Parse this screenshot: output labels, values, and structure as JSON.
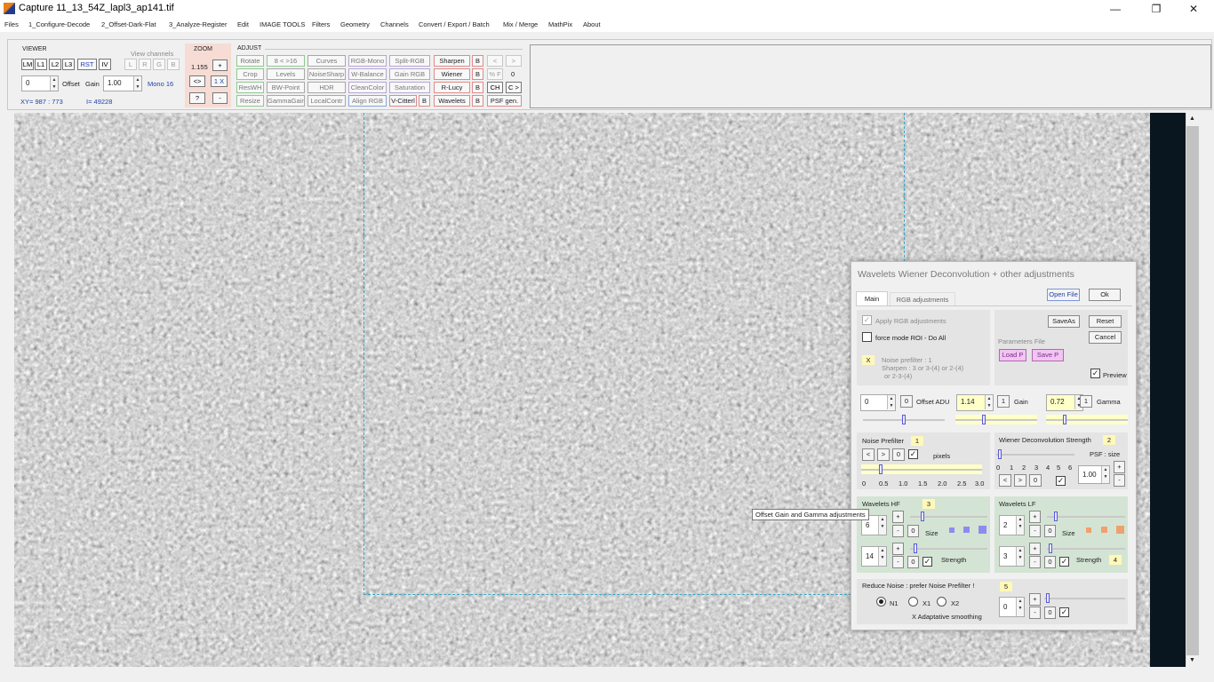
{
  "window": {
    "title": "Capture 11_13_54Z_lapl3_ap141.tif",
    "minimize": "—",
    "maximize": "❐",
    "close": "✕"
  },
  "menu": [
    "Files",
    "1_Configure-Decode",
    "2_Offset-Dark-Flat",
    "3_Analyze-Register",
    "Edit",
    "IMAGE TOOLS",
    "Filters",
    "Geometry",
    "Channels",
    "Convert / Export / Batch",
    "Mix / Merge",
    "MathPix",
    "About"
  ],
  "viewer": {
    "title": "VIEWER",
    "buttons": [
      "LM",
      "L1",
      "L2",
      "L3",
      "RST",
      "IV"
    ],
    "view_channels_label": "View channels",
    "channel_buttons": [
      "L",
      "R",
      "G",
      "B"
    ],
    "offset_value": "0",
    "offset_label": "Offset",
    "gain_label": "Gain",
    "gain_value": "1.00",
    "mode": "Mono 16",
    "xy": "XY= 987 : 773",
    "intensity": "I= 49228"
  },
  "zoom": {
    "title": "ZOOM",
    "value": "1.155",
    "plus": "+",
    "fit": "<>",
    "one_x": "1 X",
    "help": "?",
    "minus": "-"
  },
  "adjust": {
    "title": "ADJUST",
    "col1": [
      "Rotate",
      "Crop",
      "ResWH",
      "Resize"
    ],
    "col2": [
      "8 < >16",
      "Levels",
      "BW-Point",
      "GammaGain"
    ],
    "col3": [
      "Curves",
      "NoiseSharp",
      "HDR",
      "LocalContr"
    ],
    "col4": [
      "RGB-Mono",
      "W-Balance",
      "CleanColor",
      "Align RGB"
    ],
    "col5": [
      "Split-RGB",
      "Gain RGB",
      "Saturation",
      "V-Citterl"
    ],
    "col6": [
      "Sharpen",
      "Wiener",
      "R-Lucy",
      "Wavelets"
    ],
    "b_label": "B",
    "nav_prev": "<",
    "nav_next": ">",
    "percent_f": "% F",
    "zero": "0",
    "ch": "CH",
    "c_arrow": "C >",
    "psf_gen": "PSF gen."
  },
  "tooltip": "Offset Gain and Gamma adjustments",
  "dialog": {
    "title": "Wavelets Wiener Deconvolution + other adjustments",
    "tab_main": "Main",
    "tab_rgb": "RGB adjustments",
    "open_file": "Open File",
    "ok": "Ok",
    "apply_rgb": "Apply RGB adjustments",
    "force_mode": "force mode  ROI - Do All",
    "x_badge": "X",
    "noise_note_1": "Noise prefilter :  1",
    "noise_note_2": "Sharpen :  3  or  3-(4)  or  2-(4)",
    "noise_note_3": "or  2-3-(4)",
    "save_as": "SaveAs",
    "reset": "Reset",
    "cancel": "Cancel",
    "parameters_file": "Parameters File",
    "load_p": "Load P",
    "save_p": "Save P",
    "preview": "Preview",
    "offset_value": "0",
    "offset_reset": "0",
    "offset_label": "Offset ADU",
    "gain_value": "1.14",
    "gain_reset": "1",
    "gain_label": "Gain",
    "gamma_value": "0.72",
    "gamma_reset": "1",
    "gamma_label": "Gamma",
    "offset_slider": 0.5,
    "gain_slider": 0.35,
    "gamma_slider": 0.22,
    "noise_prefilter_label": "Noise Prefilter",
    "noise_prefilter_badge": "1",
    "pixels_label": "pixels",
    "noise_ticks": [
      "0",
      "0.5",
      "1.0",
      "1.5",
      "2.0",
      "2.5",
      "3.0"
    ],
    "noise_zero": "0",
    "noise_slider": 0.15,
    "wiener_label": "Wiener Deconvolution Strength",
    "wiener_badge": "2",
    "psf_size_label": "PSF : size",
    "wiener_ticks": [
      "0",
      "1",
      "2",
      "3",
      "4",
      "5",
      "6"
    ],
    "wiener_zero": "0",
    "psf_value": "1.00",
    "wiener_slider": 0.02,
    "hf_label": "Wavelets HF",
    "hf_badge": "3",
    "hf_size_value": "6",
    "hf_strength_value": "14",
    "hf_size_zero": "0",
    "hf_strength_zero": "0",
    "size_label": "Size",
    "strength_label": "Strength",
    "hf_size_slider": 0.15,
    "hf_strength_slider": 0.05,
    "lf_label": "Wavelets LF",
    "lf_size_value": "2",
    "lf_strength_value": "3",
    "lf_size_zero": "0",
    "lf_strength_zero": "0",
    "lf_badge": "4",
    "lf_size_slider": 0.1,
    "lf_strength_slider": 0.03,
    "reduce_noise_label": "Reduce Noise :  prefer Noise Prefilter !",
    "reduce_noise_badge": "5",
    "n1": "N1",
    "x1": "X1",
    "x2": "X2",
    "adaptative": "X Adaptative smoothing",
    "reduce_value": "0",
    "reduce_zero": "0",
    "reduce_slider": 0.02,
    "plus": "+",
    "minus": "-",
    "lt": "<",
    "gt": ">",
    "check": "✓"
  },
  "colors": {
    "hf_squares": "#8c8cf0",
    "lf_squares": "#f0a070",
    "badge_yellow": "#fff8b8",
    "section_green": "#d4e4d4"
  }
}
